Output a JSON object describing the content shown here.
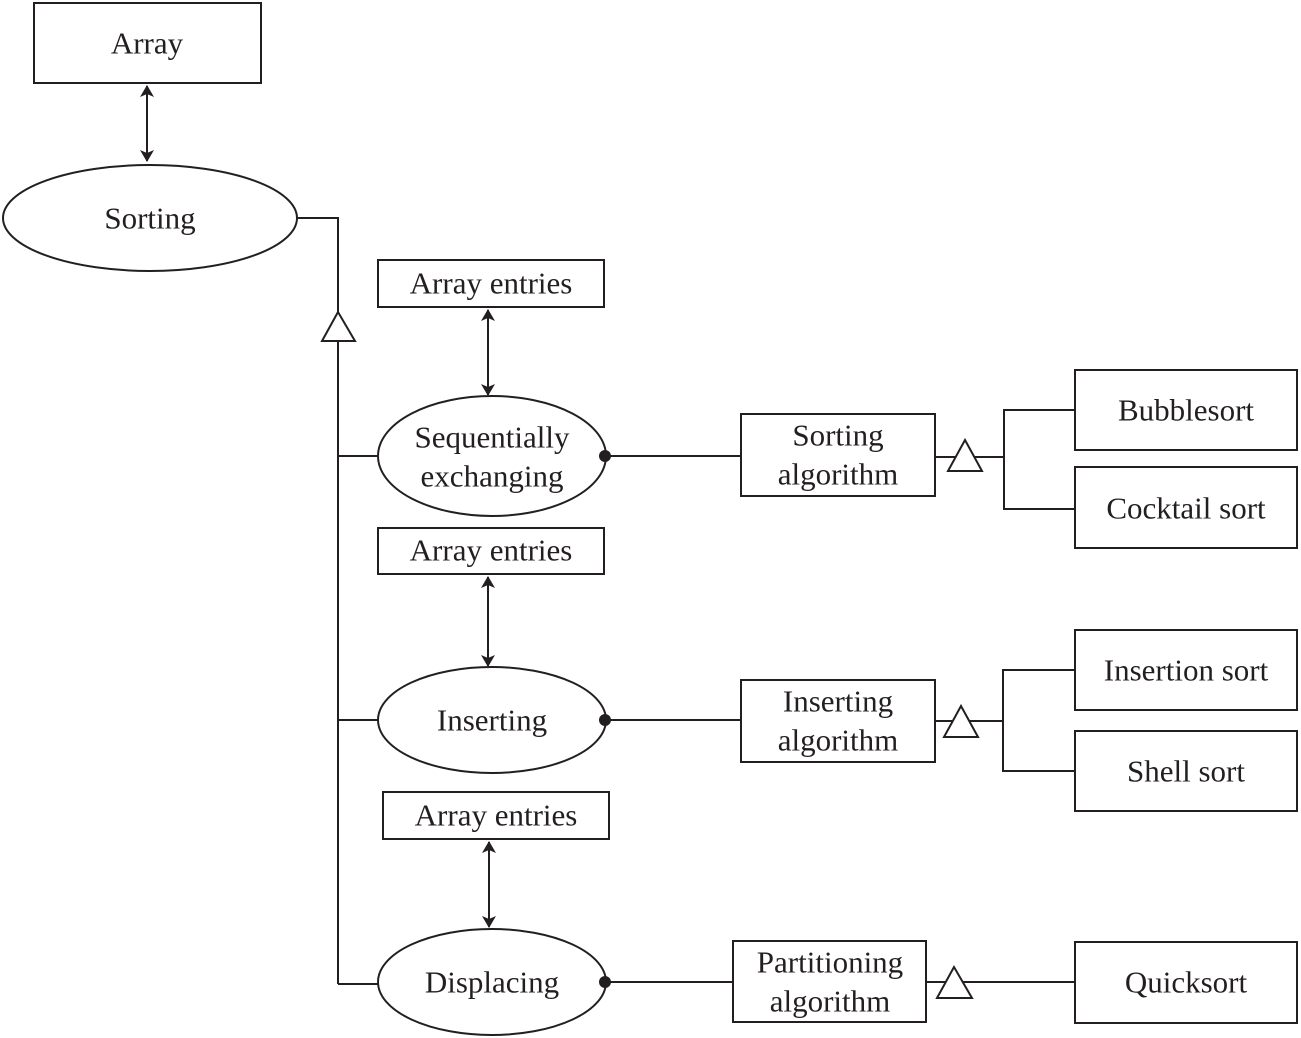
{
  "nodes": {
    "array": "Array",
    "sorting": "Sorting",
    "entries1": "Array entries",
    "entries2": "Array entries",
    "entries3": "Array entries",
    "seq_line1": "Sequentially",
    "seq_line2": "exchanging",
    "inserting": "Inserting",
    "displacing": "Displacing",
    "sort_alg_line1": "Sorting",
    "sort_alg_line2": "algorithm",
    "ins_alg_line1": "Inserting",
    "ins_alg_line2": "algorithm",
    "part_alg_line1": "Partitioning",
    "part_alg_line2": "algorithm",
    "bubblesort": "Bubblesort",
    "cocktail": "Cocktail sort",
    "insertion": "Insertion sort",
    "shell": "Shell sort",
    "quicksort": "Quicksort"
  }
}
